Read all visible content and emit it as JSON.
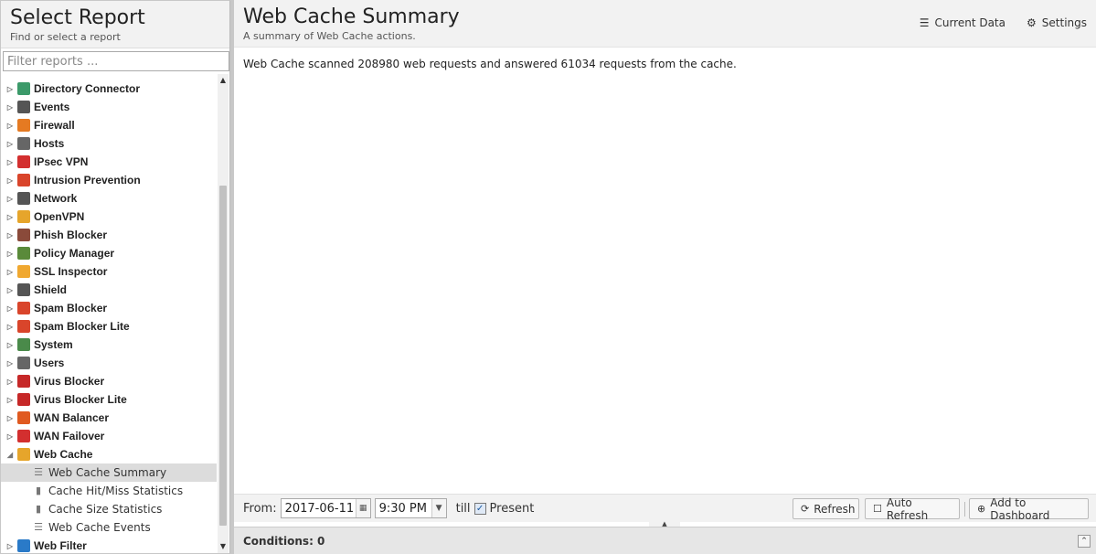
{
  "left": {
    "title": "Select Report",
    "subtitle": "Find or select a report",
    "filter_placeholder": "Filter reports ..."
  },
  "tree": [
    {
      "label": "Directory Connector",
      "icon": "directory-connector-icon",
      "color": "#3c9a6a"
    },
    {
      "label": "Events",
      "icon": "events-icon",
      "color": "#555555"
    },
    {
      "label": "Firewall",
      "icon": "firewall-icon",
      "color": "#e57a22"
    },
    {
      "label": "Hosts",
      "icon": "hosts-icon",
      "color": "#666666"
    },
    {
      "label": "IPsec VPN",
      "icon": "ipsec-vpn-icon",
      "color": "#d32f2f"
    },
    {
      "label": "Intrusion Prevention",
      "icon": "intrusion-prevention-icon",
      "color": "#d9452b"
    },
    {
      "label": "Network",
      "icon": "network-icon",
      "color": "#555555"
    },
    {
      "label": "OpenVPN",
      "icon": "openvpn-icon",
      "color": "#e6a52b"
    },
    {
      "label": "Phish Blocker",
      "icon": "phish-blocker-icon",
      "color": "#8a4a3a"
    },
    {
      "label": "Policy Manager",
      "icon": "policy-manager-icon",
      "color": "#5a8a3a"
    },
    {
      "label": "SSL Inspector",
      "icon": "ssl-inspector-icon",
      "color": "#f0a830"
    },
    {
      "label": "Shield",
      "icon": "shield-icon",
      "color": "#555555"
    },
    {
      "label": "Spam Blocker",
      "icon": "spam-blocker-icon",
      "color": "#d9452b"
    },
    {
      "label": "Spam Blocker Lite",
      "icon": "spam-blocker-lite-icon",
      "color": "#d9452b"
    },
    {
      "label": "System",
      "icon": "system-icon",
      "color": "#4a8a4a"
    },
    {
      "label": "Users",
      "icon": "users-icon",
      "color": "#666666"
    },
    {
      "label": "Virus Blocker",
      "icon": "virus-blocker-icon",
      "color": "#c62828"
    },
    {
      "label": "Virus Blocker Lite",
      "icon": "virus-blocker-lite-icon",
      "color": "#c62828"
    },
    {
      "label": "WAN Balancer",
      "icon": "wan-balancer-icon",
      "color": "#e05a20"
    },
    {
      "label": "WAN Failover",
      "icon": "wan-failover-icon",
      "color": "#d32f2f"
    },
    {
      "label": "Web Cache",
      "icon": "web-cache-icon",
      "color": "#e6a52b",
      "expanded": true
    },
    {
      "label": "Web Filter",
      "icon": "web-filter-icon",
      "color": "#2a7ac8"
    }
  ],
  "web_cache_children": [
    {
      "label": "Web Cache Summary",
      "icon": "text-report-icon",
      "glyph": "☰",
      "selected": true
    },
    {
      "label": "Cache Hit/Miss Statistics",
      "icon": "bar-chart-icon",
      "glyph": "▮"
    },
    {
      "label": "Cache Size Statistics",
      "icon": "bar-chart-icon",
      "glyph": "▮"
    },
    {
      "label": "Web Cache Events",
      "icon": "list-icon",
      "glyph": "☰"
    }
  ],
  "main": {
    "title": "Web Cache Summary",
    "subtitle": "A summary of Web Cache actions.",
    "current_data": "Current Data",
    "settings": "Settings",
    "summary_text": "Web Cache scanned 208980 web requests and answered 61034 requests from the cache."
  },
  "toolbar": {
    "from_label": "From:",
    "date": "2017-06-11",
    "time": "9:30 PM",
    "till_label": "till",
    "present_label": "Present",
    "present_checked": true,
    "refresh": "Refresh",
    "auto_refresh": "Auto Refresh",
    "add_to_dashboard": "Add to Dashboard"
  },
  "conditions": {
    "label": "Conditions: 0"
  }
}
